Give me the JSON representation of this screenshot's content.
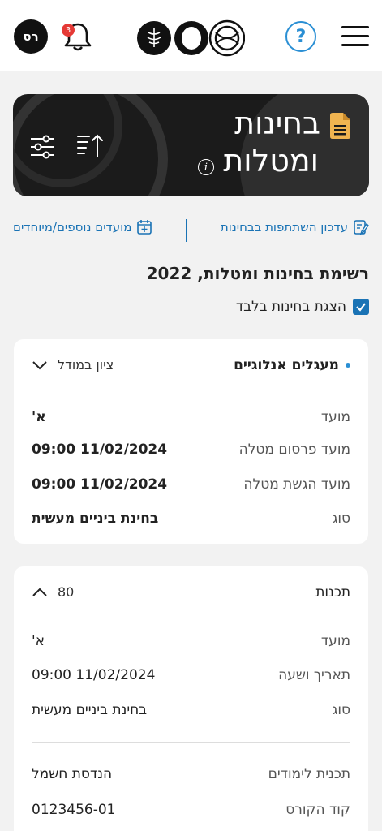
{
  "header": {
    "avatar_initials": "רס",
    "notifications_count": "3",
    "help_label": "?"
  },
  "banner": {
    "title_line1": "בחינות",
    "title_line2": "ומטלות",
    "info_label": "i",
    "doc_icon": "document-icon",
    "accent_color": "#f0b450"
  },
  "links": {
    "update_participation": "עדכון השתתפות בבחינות",
    "extra_dates": "מועדים נוספים/מיוחדים"
  },
  "list": {
    "title": "רשימת בחינות ומטלות, 2022",
    "show_exams_only": "הצגת בחינות בלבד",
    "show_exams_only_checked": true
  },
  "cards": [
    {
      "course": "מעגלים אנלוגיים",
      "grade_toggle": "ציון במודל",
      "rows": [
        {
          "label": "מועד",
          "value": "א'"
        },
        {
          "label": "מועד פרסום מטלה",
          "value": "11/02/2024 09:00"
        },
        {
          "label": "מועד הגשת מטלה",
          "value": "11/02/2024 09:00"
        },
        {
          "label": "סוג",
          "value": "בחינת ביניים מעשית"
        }
      ]
    },
    {
      "course": "תכנות",
      "grade": "80",
      "rows": [
        {
          "label": "מועד",
          "value": "א'"
        },
        {
          "label": "תאריך ושעה",
          "value": "11/02/2024 09:00"
        },
        {
          "label": "סוג",
          "value": "בחינת ביניים מעשית"
        },
        {
          "label": "תכנית לימודים",
          "value": "הנדסת חשמל"
        },
        {
          "label": "קוד הקורס",
          "value": "0123456-01"
        }
      ]
    }
  ],
  "colors": {
    "link": "#1a73b5",
    "help": "#2a8fd4",
    "badge": "#e53935",
    "banner_bg": "#1b1b1b"
  }
}
